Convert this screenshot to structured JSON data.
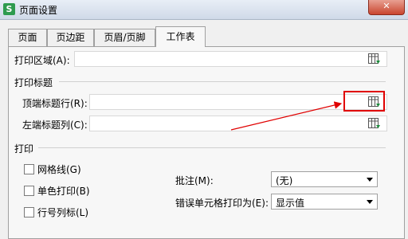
{
  "window": {
    "title": "页面设置",
    "app_icon": "S"
  },
  "tabs": [
    {
      "label": "页面",
      "active": false
    },
    {
      "label": "页边距",
      "active": false
    },
    {
      "label": "页眉/页脚",
      "active": false
    },
    {
      "label": "工作表",
      "active": true
    }
  ],
  "print_area": {
    "label": "打印区域(A):",
    "value": ""
  },
  "print_titles": {
    "heading": "打印标题",
    "top_rows": {
      "label": "顶端标题行(R):",
      "value": ""
    },
    "left_cols": {
      "label": "左端标题列(C):",
      "value": ""
    }
  },
  "print": {
    "heading": "打印",
    "gridlines": {
      "label": "网格线(G)",
      "checked": false
    },
    "mono": {
      "label": "单色打印(B)",
      "checked": false
    },
    "row_col_headers": {
      "label": "行号列标(L)",
      "checked": false
    },
    "comments": {
      "label": "批注(M):",
      "value": "(无)"
    },
    "errors": {
      "label": "错误单元格打印为(E):",
      "value": "显示值"
    }
  },
  "colors": {
    "highlight": "#e00000",
    "app_icon": "#2e9b4f"
  },
  "icons": [
    "range-picker-icon",
    "close-icon",
    "chevron-down-icon"
  ]
}
